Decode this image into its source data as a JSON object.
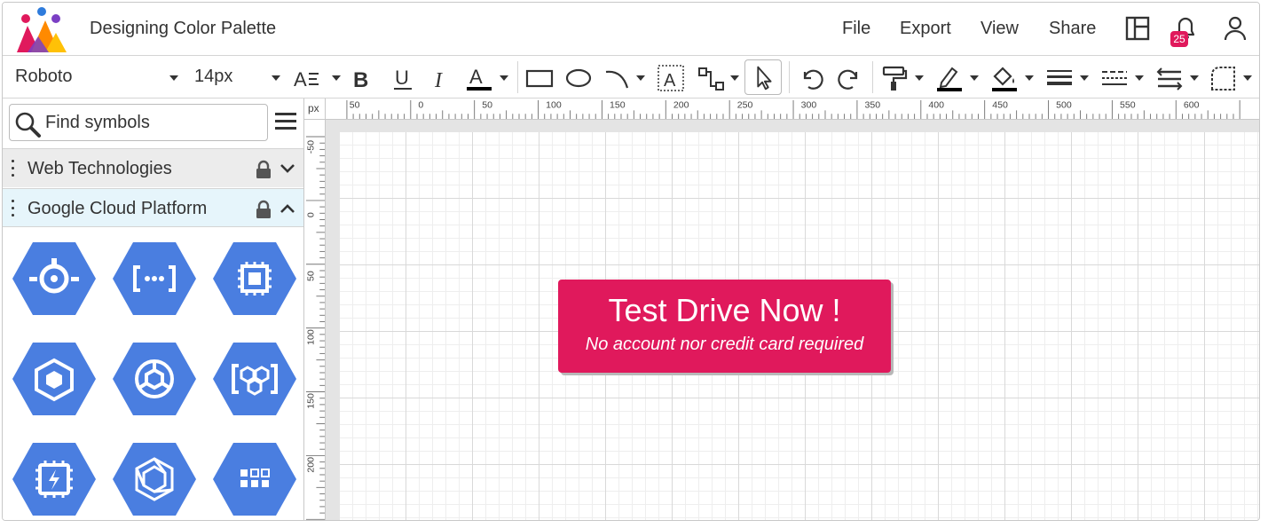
{
  "header": {
    "title": "Designing Color Palette",
    "menu": [
      "File",
      "Export",
      "View",
      "Share"
    ],
    "notification_count": "25",
    "icons": [
      "app-logo-icon",
      "layout-panels-icon",
      "bell-icon",
      "user-icon"
    ]
  },
  "toolbar": {
    "font_family": "Roboto",
    "font_size": "14px",
    "text_color": "#000000",
    "fill_color": "#000000",
    "icons": [
      "text-align-icon",
      "bold-icon",
      "underline-icon",
      "italic-icon",
      "font-color-icon",
      "rectangle-icon",
      "ellipse-icon",
      "curve-line-icon",
      "text-box-icon",
      "connector-icon",
      "pointer-icon",
      "undo-icon",
      "redo-icon",
      "format-painter-icon",
      "stroke-color-icon",
      "fill-color-icon",
      "line-weight-icon",
      "dash-style-icon",
      "line-spacing-icon",
      "corner-style-icon"
    ]
  },
  "sidebar": {
    "search_placeholder": "Find symbols",
    "groups": [
      {
        "label": "Web Technologies",
        "state": "collapsed"
      },
      {
        "label": "Google Cloud Platform",
        "state": "expanded"
      }
    ],
    "symbols": [
      "gcp-app-engine-icon",
      "gcp-cloud-endpoints-icon",
      "gcp-compute-engine-icon",
      "gcp-container-engine-icon",
      "gcp-cloud-functions-icon",
      "gcp-container-registry-icon",
      "gcp-cloud-tpu-icon",
      "gcp-kubernetes-icon",
      "gcp-apps-grid-icon"
    ],
    "symbol_color": "#4a7ee0"
  },
  "ruler": {
    "unit": "px",
    "h_labels": [
      "50",
      "0",
      "50",
      "100",
      "150",
      "200",
      "250",
      "300",
      "350",
      "400",
      "450",
      "500",
      "550",
      "600"
    ],
    "v_labels": [
      "-50",
      "0",
      "50",
      "100",
      "150",
      "200"
    ]
  },
  "canvas": {
    "cta": {
      "title": "Test Drive Now !",
      "subtitle": "No account nor credit card required",
      "color": "#e0195c"
    }
  }
}
